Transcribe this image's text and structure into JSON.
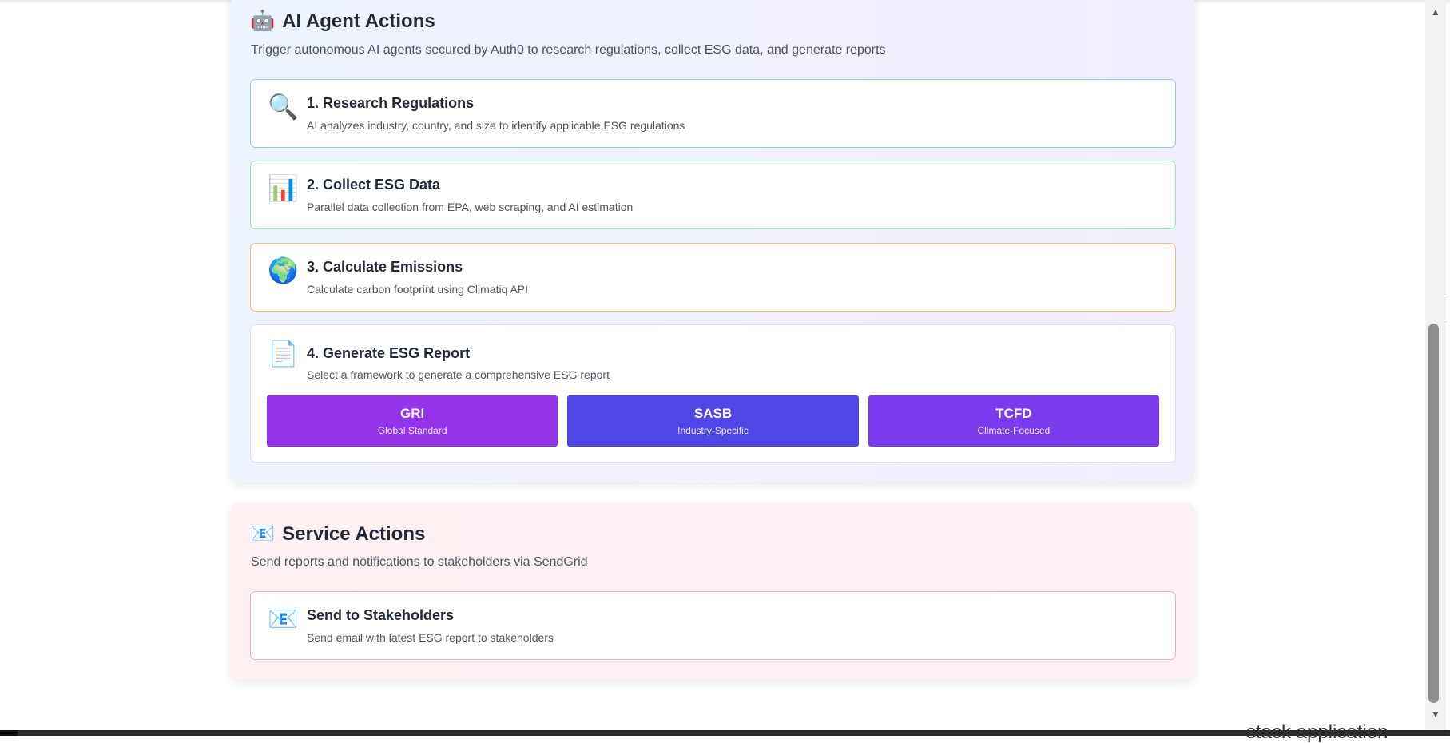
{
  "ai_section": {
    "icon": "robot-icon",
    "title": "AI Agent Actions",
    "description": "Trigger autonomous AI agents secured by Auth0 to research regulations, collect ESG data, and generate reports",
    "cards": [
      {
        "icon": "magnifier-icon",
        "title": "1. Research Regulations",
        "description": "AI analyzes industry, country, and size to identify applicable ESG regulations",
        "border_color": "#93c5fd"
      },
      {
        "icon": "bar-chart-icon",
        "title": "2. Collect ESG Data",
        "description": "Parallel data collection from EPA, web scraping, and AI estimation",
        "border_color": "#86efac"
      },
      {
        "icon": "globe-icon",
        "title": "3. Calculate Emissions",
        "description": "Calculate carbon footprint using Climatiq API",
        "border_color": "#fdba74"
      },
      {
        "icon": "document-icon",
        "title": "4. Generate ESG Report",
        "description": "Select a framework to generate a comprehensive ESG report",
        "border_color": "#d8b4fe"
      }
    ],
    "frameworks": [
      {
        "name": "GRI",
        "subtitle": "Global Standard",
        "color": "#9333ea"
      },
      {
        "name": "SASB",
        "subtitle": "Industry-Specific",
        "color": "#4f46e5"
      },
      {
        "name": "TCFD",
        "subtitle": "Climate-Focused",
        "color": "#7c3aed"
      }
    ]
  },
  "service_section": {
    "icon": "email-icon",
    "title": "Service Actions",
    "description": "Send reports and notifications to stakeholders via SendGrid",
    "card": {
      "icon": "email-icon",
      "title": "Send to Stakeholders",
      "description": "Send email with latest ESG report to stakeholders",
      "border_color": "#f9a8d4"
    }
  },
  "background_peek_text": "stack application"
}
